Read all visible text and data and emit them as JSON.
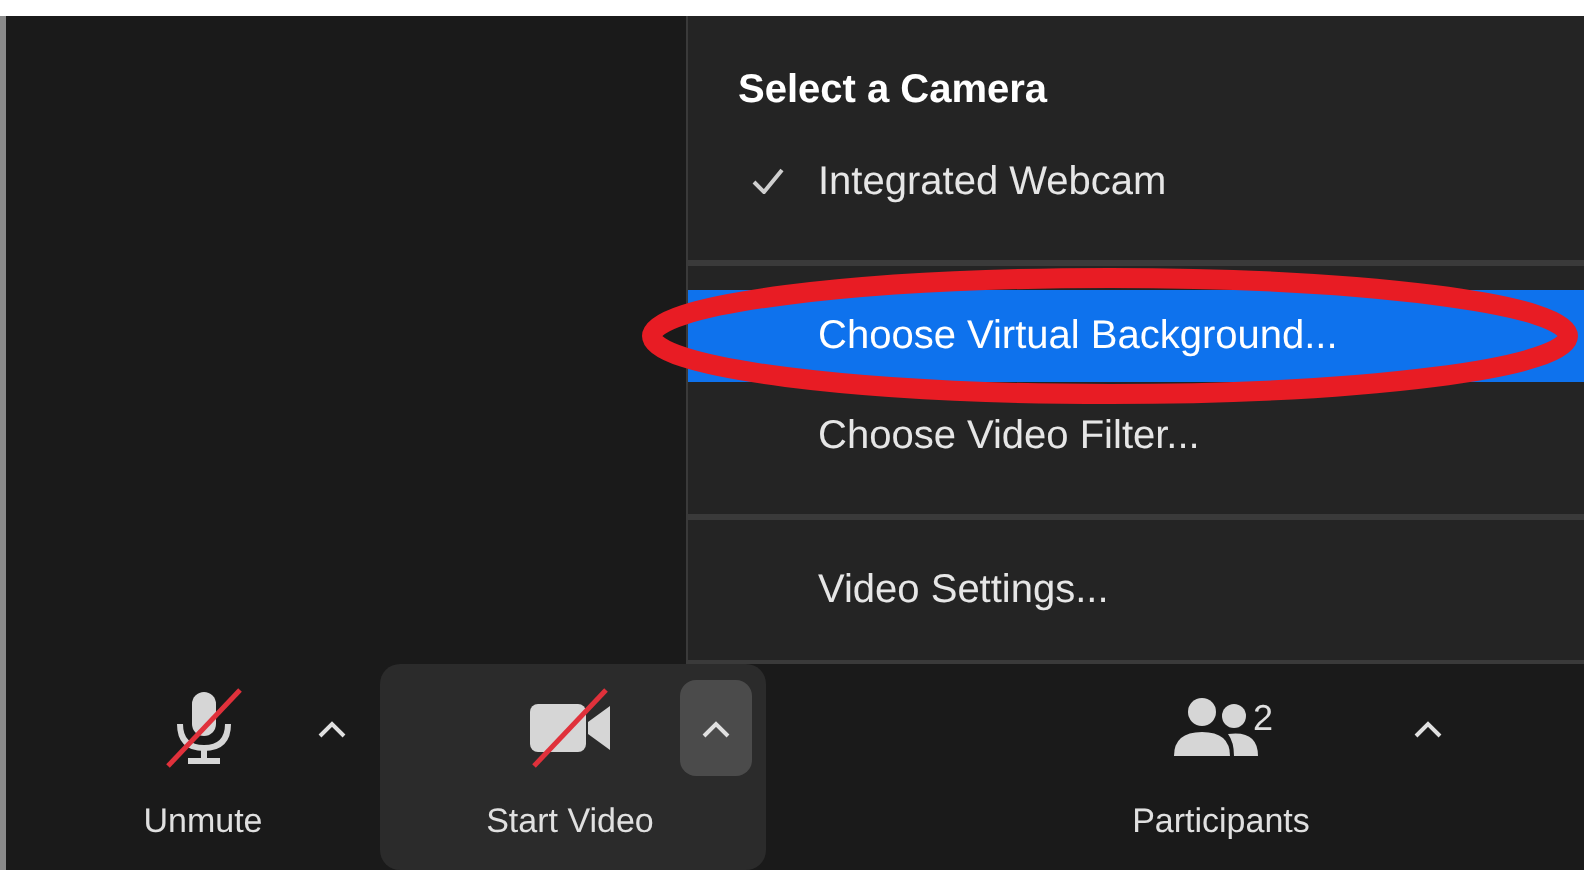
{
  "camera_menu": {
    "items": [
      {
        "kind": "header",
        "label": "Select a Camera"
      },
      {
        "kind": "item",
        "label": "Integrated Webcam",
        "checked": true,
        "selected": false
      },
      {
        "kind": "divider"
      },
      {
        "kind": "item",
        "label": "Choose Virtual Background...",
        "checked": false,
        "selected": true
      },
      {
        "kind": "item",
        "label": "Choose Video Filter...",
        "checked": false,
        "selected": false
      },
      {
        "kind": "divider"
      },
      {
        "kind": "item",
        "label": "Video Settings...",
        "checked": false,
        "selected": false
      }
    ]
  },
  "toolbar": {
    "buttons": [
      {
        "kind": "microphone",
        "label": "Unmute",
        "off": true,
        "hovered": false,
        "caret_active": false
      },
      {
        "kind": "camera",
        "label": "Start Video",
        "off": true,
        "hovered": true,
        "caret_active": true
      },
      {
        "kind": "people",
        "label": "Participants",
        "count": "2",
        "off": false,
        "hovered": false,
        "caret_active": false
      }
    ]
  }
}
